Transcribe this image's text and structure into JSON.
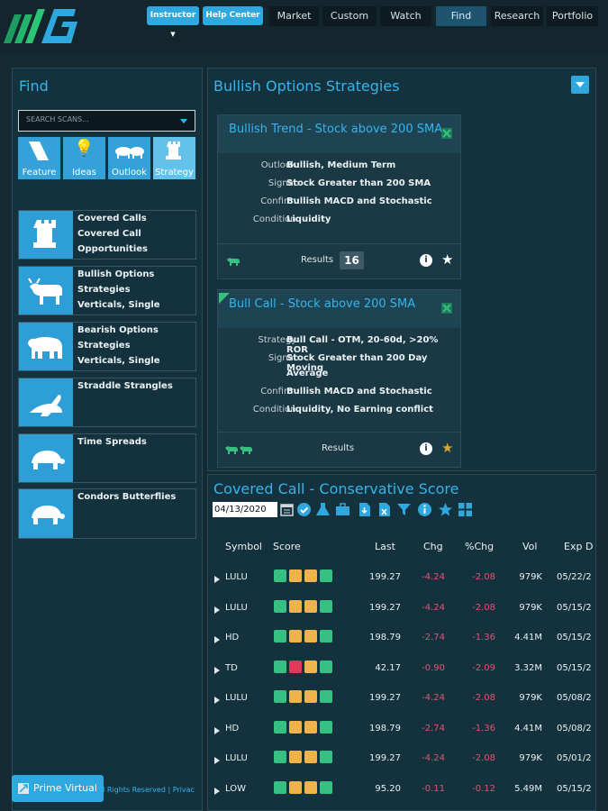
{
  "header": {
    "instructor_label": "Instructor",
    "help_label": "Help Center",
    "tabs": [
      "Market",
      "Custom",
      "Watch",
      "Find",
      "Research",
      "Portfolio"
    ],
    "active_tab": "Find"
  },
  "find_panel": {
    "title": "Find",
    "search_placeholder": "SEARCH SCANS...",
    "categories": [
      {
        "label": "Feature",
        "icon": "feature-icon"
      },
      {
        "label": "Ideas",
        "icon": "lightbulb-icon"
      },
      {
        "label": "Outlook",
        "icon": "bull-bear-icon"
      },
      {
        "label": "Strategy",
        "icon": "chess-rook-icon"
      }
    ],
    "active_category": "Strategy",
    "scans": [
      {
        "title": "Covered Calls",
        "line2": "Covered Call",
        "line3": "Opportunities",
        "line4": "",
        "icon": "rook-icon"
      },
      {
        "title": "Bullish Options",
        "line2": "Strategies",
        "line3": "Verticals, Single",
        "line4": "",
        "icon": "bull-icon"
      },
      {
        "title": "Bearish Options",
        "line2": "Strategies",
        "line3": "Verticals, Single",
        "line4": "",
        "icon": "bear-icon"
      },
      {
        "title": "Straddle Strangles",
        "line2": "",
        "line3": "",
        "line4": "",
        "icon": "rabbit-icon"
      },
      {
        "title": "Time Spreads",
        "line2": "",
        "line3": "",
        "line4": "",
        "icon": "turtle-icon"
      },
      {
        "title": "Condors Butterflies",
        "line2": "",
        "line3": "",
        "line4": "",
        "icon": "turtle-icon"
      }
    ]
  },
  "strategies_panel": {
    "title": "Bullish Options Strategies",
    "cards": [
      {
        "title": "Bullish Trend - Stock above 200 SMA",
        "rows": [
          {
            "k": "Outlook:",
            "v": "Bullish, Medium Term"
          },
          {
            "k": "Signal:",
            "v": "Stock Greater than 200 SMA"
          },
          {
            "k": "Confirm:",
            "v": "Bullish MACD and Stochastic"
          },
          {
            "k": "Condition:",
            "v": "Liquidity"
          }
        ],
        "results_label": "Results",
        "results_count": "16"
      },
      {
        "title": "Bull Call - Stock above 200 SMA",
        "rows": [
          {
            "k": "Strategy:",
            "v": "Bull Call - OTM, 20-60d, >20% ROR"
          },
          {
            "k": "Signal:",
            "v": "Stock Greater than 200 Day Moving"
          },
          {
            "k": "",
            "v": "Average"
          },
          {
            "k": "Confirm:",
            "v": "Bullish MACD and Stochastic"
          },
          {
            "k": "Condition:",
            "v": "Liquidity, No Earning conflict"
          }
        ],
        "results_label": "Results",
        "results_count": ""
      }
    ]
  },
  "score_panel": {
    "title": "Covered Call - Conservative Score",
    "date_value": "04/13/2020",
    "columns": [
      "Symbol",
      "Score",
      "Last",
      "Chg",
      "%Chg",
      "Vol",
      "Exp D"
    ],
    "rows": [
      {
        "symbol": "LULU",
        "last": "199.27",
        "chg": "-4.24",
        "pchg": "-2.08",
        "vol": "979K",
        "exp": "05/22/2",
        "s2": "orange"
      },
      {
        "symbol": "LULU",
        "last": "199.27",
        "chg": "-4.24",
        "pchg": "-2.08",
        "vol": "979K",
        "exp": "05/15/2",
        "s2": "orange"
      },
      {
        "symbol": "HD",
        "last": "198.79",
        "chg": "-2.74",
        "pchg": "-1.36",
        "vol": "4.41M",
        "exp": "05/15/2",
        "s2": "orange"
      },
      {
        "symbol": "TD",
        "last": "42.17",
        "chg": "-0.90",
        "pchg": "-2.09",
        "vol": "3.32M",
        "exp": "05/15/2",
        "s2": "red"
      },
      {
        "symbol": "LULU",
        "last": "199.27",
        "chg": "-4.24",
        "pchg": "-2.08",
        "vol": "979K",
        "exp": "05/08/2",
        "s2": "orange"
      },
      {
        "symbol": "HD",
        "last": "198.79",
        "chg": "-2.74",
        "pchg": "-1.36",
        "vol": "4.41M",
        "exp": "05/08/2",
        "s2": "orange"
      },
      {
        "symbol": "LULU",
        "last": "199.27",
        "chg": "-4.24",
        "pchg": "-2.08",
        "vol": "979K",
        "exp": "05/01/2",
        "s2": "orange"
      },
      {
        "symbol": "LOW",
        "last": "95.20",
        "chg": "-0.11",
        "pchg": "-0.12",
        "vol": "5.49M",
        "exp": "05/15/2",
        "s2": "orange"
      }
    ]
  },
  "footer": {
    "badge_label": "Prime Virtual",
    "copyright_text": "I Rights Reserved | Privac"
  },
  "colors": {
    "accent": "#35b4eb",
    "button": "#2fa8df",
    "negative": "#e0556d",
    "score_green": "#36c081",
    "score_orange": "#f0b24a",
    "score_red": "#e23b5a",
    "star_gold": "#d6a72f"
  }
}
